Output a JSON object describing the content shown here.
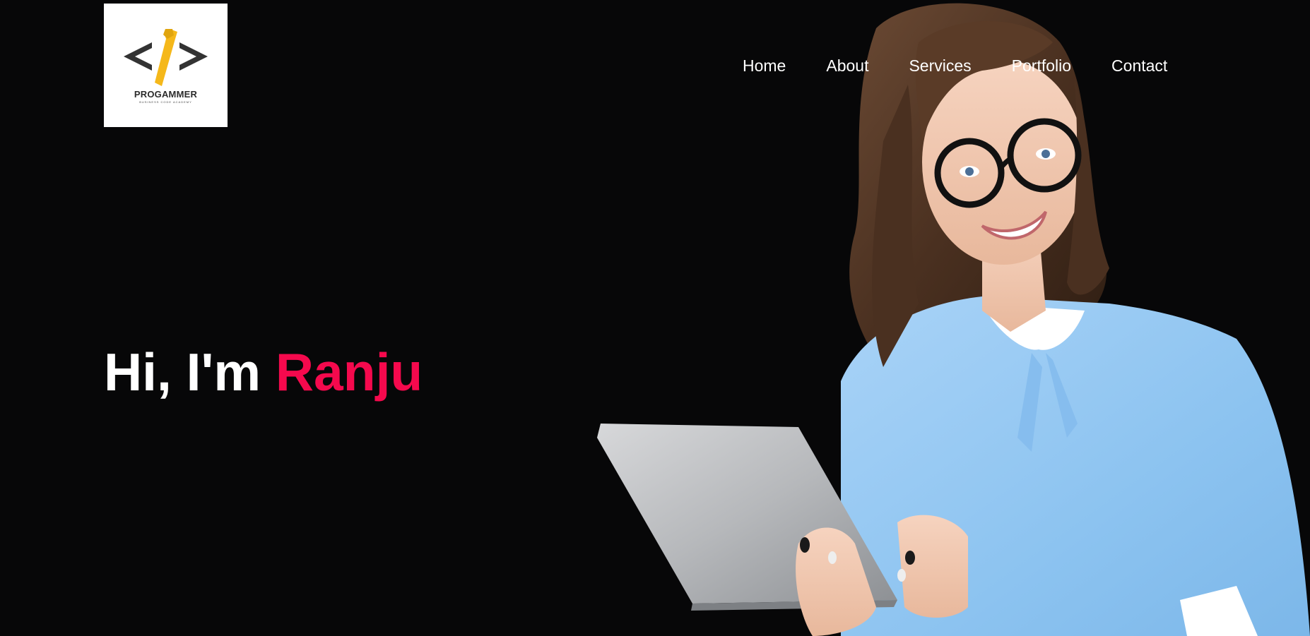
{
  "brand": {
    "name": "PROGAMMER",
    "tagline": "BUSINESS CODE ACADEMY",
    "icon": "code-tie-icon",
    "accent_color": "#f5b81a"
  },
  "nav": {
    "items": [
      {
        "label": "Home"
      },
      {
        "label": "About"
      },
      {
        "label": "Services"
      },
      {
        "label": "Portfolio"
      },
      {
        "label": "Contact"
      }
    ]
  },
  "hero": {
    "greeting": "Hi, I'm",
    "name": "Ranju",
    "name_color": "#f5094d",
    "background_color": "#070708",
    "image": "woman-with-tablet-photo"
  }
}
